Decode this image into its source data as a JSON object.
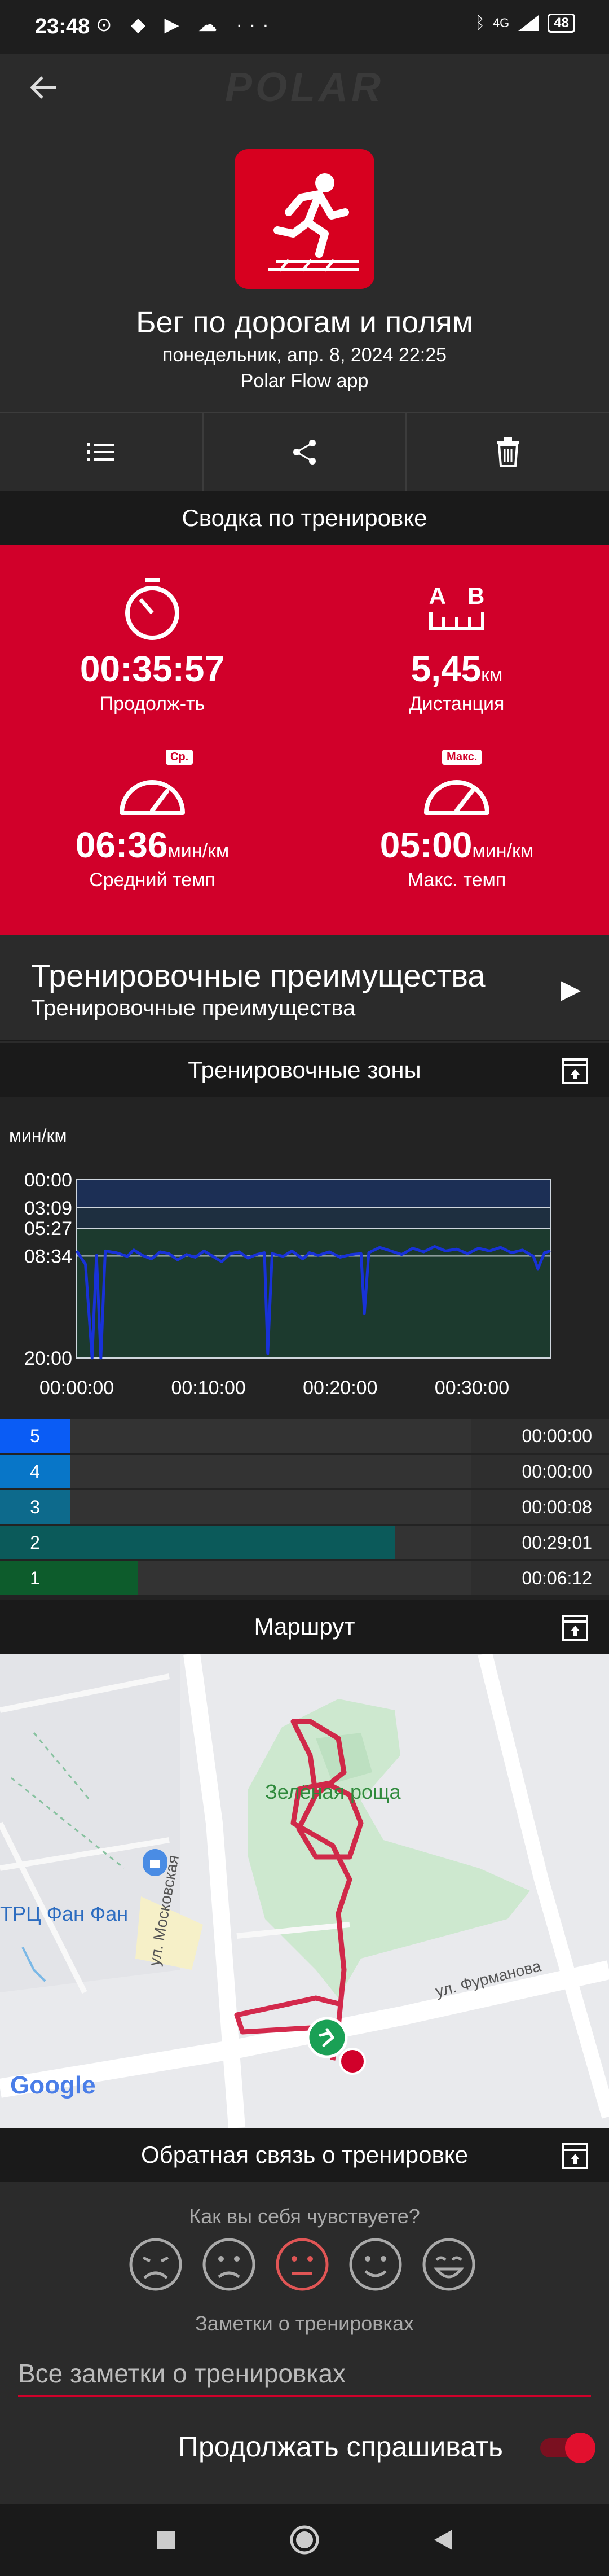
{
  "status_bar": {
    "time": "23:48",
    "left_icons": "⊙ ◆ ▶ ☁ ···",
    "network": "4G",
    "battery": "48"
  },
  "header": {
    "logo_text": "POLAR",
    "sport_name": "Бег по дорогам и полям",
    "date": "понедельник, апр. 8, 2024 22:25",
    "source": "Polar Flow app"
  },
  "summary": {
    "title": "Сводка по тренировке",
    "duration": {
      "value": "00:35:57",
      "label": "Продолж-ть"
    },
    "distance": {
      "value": "5,45",
      "unit": "км",
      "label": "Дистанция",
      "icon_letters": [
        "A",
        "B"
      ]
    },
    "avg_pace": {
      "value": "06:36",
      "unit": "мин/км",
      "label": "Средний темп",
      "badge": "Ср."
    },
    "max_pace": {
      "value": "05:00",
      "unit": "мин/км",
      "label": "Макс. темп",
      "badge": "Макс."
    }
  },
  "benefits": {
    "title": "Тренировочные преимущества",
    "subtitle": "Тренировочные преимущества"
  },
  "zones_section": {
    "title": "Тренировочные зоны"
  },
  "chart_data": {
    "type": "line",
    "ylabel": "мин/км",
    "y_ticks": [
      "00:00",
      "03:09",
      "05:27",
      "08:34",
      "20:00"
    ],
    "x_ticks": [
      "00:00:00",
      "00:10:00",
      "00:20:00",
      "00:30:00"
    ],
    "y_range_minutes": [
      0,
      20
    ],
    "x_range_seconds": [
      0,
      2157
    ],
    "series": [
      {
        "values": [
          [
            0,
            8.0
          ],
          [
            40,
            9.5
          ],
          [
            70,
            20.0
          ],
          [
            90,
            8.5
          ],
          [
            110,
            20.0
          ],
          [
            130,
            8.0
          ],
          [
            180,
            8.2
          ],
          [
            230,
            8.6
          ],
          [
            260,
            7.9
          ],
          [
            300,
            8.5
          ],
          [
            340,
            8.9
          ],
          [
            380,
            8.1
          ],
          [
            420,
            8.3
          ],
          [
            460,
            9.0
          ],
          [
            500,
            8.4
          ],
          [
            540,
            8.7
          ],
          [
            580,
            8.0
          ],
          [
            620,
            8.6
          ],
          [
            660,
            9.2
          ],
          [
            700,
            8.3
          ],
          [
            740,
            8.1
          ],
          [
            780,
            8.8
          ],
          [
            820,
            8.4
          ],
          [
            855,
            8.2
          ],
          [
            870,
            19.5
          ],
          [
            890,
            8.3
          ],
          [
            940,
            8.6
          ],
          [
            980,
            8.0
          ],
          [
            1030,
            8.9
          ],
          [
            1060,
            8.2
          ],
          [
            1100,
            8.5
          ],
          [
            1150,
            8.1
          ],
          [
            1200,
            8.7
          ],
          [
            1250,
            8.4
          ],
          [
            1295,
            8.3
          ],
          [
            1310,
            15.0
          ],
          [
            1330,
            8.2
          ],
          [
            1380,
            7.6
          ],
          [
            1430,
            8.0
          ],
          [
            1480,
            8.4
          ],
          [
            1530,
            7.7
          ],
          [
            1580,
            8.1
          ],
          [
            1630,
            7.5
          ],
          [
            1680,
            8.0
          ],
          [
            1730,
            7.8
          ],
          [
            1780,
            8.3
          ],
          [
            1830,
            7.7
          ],
          [
            1880,
            8.0
          ],
          [
            1930,
            7.6
          ],
          [
            1980,
            8.2
          ],
          [
            2030,
            7.9
          ],
          [
            2080,
            8.6
          ],
          [
            2100,
            10.0
          ],
          [
            2130,
            8.2
          ],
          [
            2157,
            8.0
          ]
        ]
      }
    ],
    "colors": {
      "line": "#1832d8",
      "zone": "#1c3a2e"
    }
  },
  "zones": [
    {
      "zone": "5",
      "time": "00:00:00",
      "fraction": 0.0,
      "color": "#0a5cf5"
    },
    {
      "zone": "4",
      "time": "00:00:00",
      "fraction": 0.0,
      "color": "#0876c8"
    },
    {
      "zone": "3",
      "time": "00:00:08",
      "fraction": 0.0,
      "color": "#0d6a8c"
    },
    {
      "zone": "2",
      "time": "00:29:01",
      "fraction": 0.81,
      "color": "#0b5a5a"
    },
    {
      "zone": "1",
      "time": "00:06:12",
      "fraction": 0.17,
      "color": "#0d5c2c"
    }
  ],
  "route": {
    "title": "Маршрут",
    "park_label": "Зелёная роща",
    "mall_label": "ТРЦ Фан Фан",
    "street_1": "ул. Московская",
    "street_2": "ул. Фурманова",
    "provider": "Google"
  },
  "feedback": {
    "title": "Обратная связь о тренировке",
    "question": "Как вы себя чувствуете?",
    "notes_label": "Заметки о тренировках",
    "notes_placeholder": "Все заметки о тренировках",
    "keep_asking": "Продолжать спрашивать",
    "selected_face": 3
  },
  "colors": {
    "brand_red": "#d1002a",
    "background": "#2b2b2b"
  }
}
